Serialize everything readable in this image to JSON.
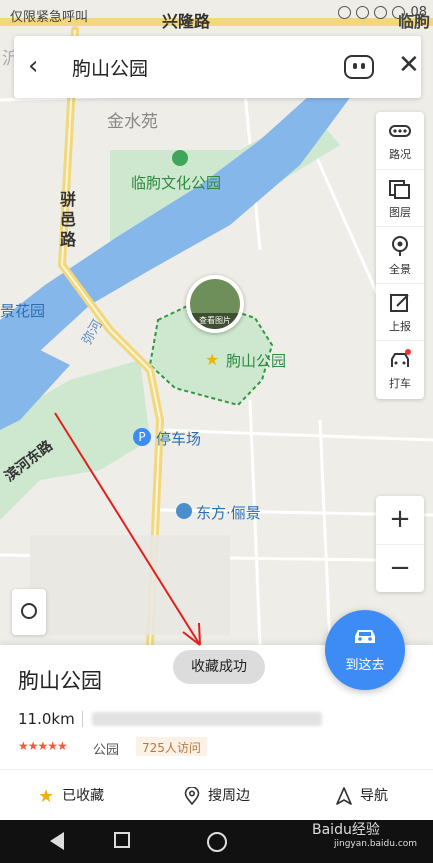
{
  "status_bar": {
    "left_text": "仅限紧急呼叫",
    "time": "08"
  },
  "search": {
    "query": "朐山公园"
  },
  "map": {
    "labels": {
      "top_road": "兴隆路",
      "top_left_partial": "沂术",
      "jinshuiyuan": "金水苑",
      "culture_park": "临朐文化公园",
      "pianyi_road": "骈邑路",
      "jing_garden": "景花园",
      "river": "弥河",
      "park": "朐山公园",
      "park_photo": "查看图片",
      "parking": "停车场",
      "binhe_road": "滨河东路",
      "dongfang": "东方·俪景",
      "right_partial": "临朐"
    }
  },
  "tools": {
    "items": [
      {
        "label": "路况",
        "icon": "traffic-icon"
      },
      {
        "label": "图层",
        "icon": "layers-icon"
      },
      {
        "label": "全景",
        "icon": "panorama-icon"
      },
      {
        "label": "上报",
        "icon": "report-icon"
      },
      {
        "label": "打车",
        "icon": "taxi-icon"
      }
    ],
    "zoom_in": "+",
    "zoom_out": "−"
  },
  "goto_button": {
    "label": "到这去"
  },
  "toast": {
    "text": "收藏成功"
  },
  "place_card": {
    "name": "朐山公园",
    "distance": "11.0km",
    "rating_stars": "★★★★★",
    "category": "公园",
    "visits": "725人访问"
  },
  "actions": {
    "favorited": "已收藏",
    "nearby": "搜周边",
    "navigate": "导航"
  },
  "watermark": {
    "brand": "Baidu经验",
    "url": "jingyan.baidu.com"
  },
  "colors": {
    "accent": "#3d8cf5",
    "river": "#86b7ea",
    "park": "#cfe9cf",
    "road": "#f2d77c"
  }
}
